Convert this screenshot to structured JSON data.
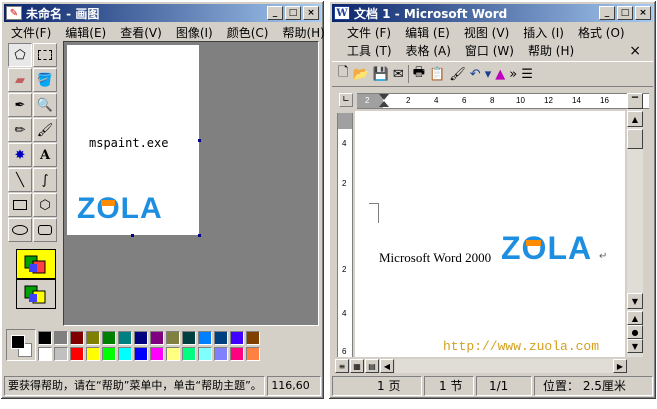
{
  "paint": {
    "title": "未命名 - 画图",
    "menu": [
      "文件(F)",
      "编辑(E)",
      "查看(V)",
      "图像(I)",
      "颜色(C)",
      "帮助(H)"
    ],
    "canvas_text": "mspaint.exe",
    "logo": "ZOLA",
    "status_help": "要获得帮助，请在“帮助”菜单中，单击“帮助主题”。",
    "status_coord": "116,60",
    "palette_top": [
      "#000000",
      "#808080",
      "#800000",
      "#808000",
      "#008000",
      "#008080",
      "#000080",
      "#800080",
      "#808040",
      "#004040",
      "#0080ff",
      "#004080",
      "#4000ff",
      "#804000"
    ],
    "palette_bottom": [
      "#ffffff",
      "#c0c0c0",
      "#ff0000",
      "#ffff00",
      "#00ff00",
      "#00ffff",
      "#0000ff",
      "#ff00ff",
      "#ffff80",
      "#00ff80",
      "#80ffff",
      "#8080ff",
      "#ff0080",
      "#ff8040"
    ]
  },
  "word": {
    "title": "文档 1 - Microsoft Word",
    "menu_row1": [
      "文件 (F)",
      "编辑 (E)",
      "视图 (V)",
      "插入 (I)",
      "格式 (O)"
    ],
    "menu_row2": [
      "工具 (T)",
      "表格 (A)",
      "窗口 (W)",
      "帮助 (H)"
    ],
    "close_doc": "×",
    "body_text": "Microsoft Word 2000",
    "logo": "ZOLA",
    "para_mark": "↵",
    "ruler_h": [
      "2",
      "2",
      "4",
      "6",
      "8",
      "10",
      "12",
      "14",
      "16"
    ],
    "ruler_v": [
      "4",
      "2",
      "2",
      "4",
      "6"
    ],
    "watermark": "http://www.zuola.com",
    "status_page": "1 页",
    "status_section": "1 节",
    "status_pos": "1/1",
    "status_at": "位置： 2.5厘米"
  }
}
